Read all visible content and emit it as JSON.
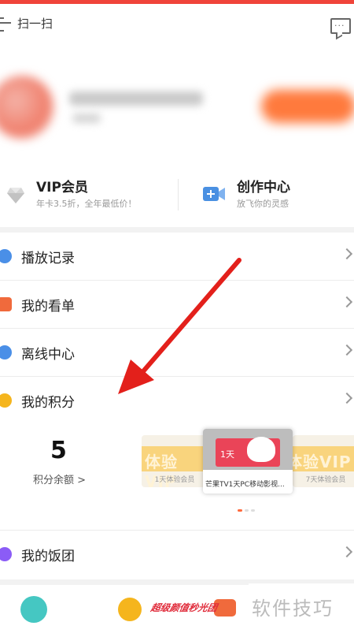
{
  "header": {
    "scan_label": "扫一扫"
  },
  "cards": {
    "vip": {
      "title": "VIP会员",
      "subtitle": "年卡3.5折，全年最低价！"
    },
    "create": {
      "title": "创作中心",
      "subtitle": "放飞你的灵感"
    }
  },
  "menu": [
    {
      "label": "播放记录",
      "icon": "history-icon",
      "color": "#4a8fe7"
    },
    {
      "label": "我的看单",
      "icon": "heart-list-icon",
      "color": "#f06a3c"
    },
    {
      "label": "离线中心",
      "icon": "download-icon",
      "color": "#4a8fe7"
    },
    {
      "label": "我的积分",
      "icon": "points-icon",
      "color": "#f5b51d"
    }
  ],
  "points": {
    "value": "5",
    "label": "积分余额 >"
  },
  "banners": {
    "left": {
      "text": "体验VIP",
      "caption": "1天体验会员"
    },
    "main": {
      "ticket": "1天",
      "caption": "芒果TV1天PC移动影视..."
    },
    "right": {
      "text": "体验VIP",
      "caption": "7天体验会员"
    }
  },
  "group": {
    "label": "我的饭团",
    "icon": "group-icon",
    "color": "#8b5cf6"
  },
  "bottom": {
    "promo": "超级颜值秒光团",
    "watermark": "软件技巧"
  },
  "colors": {
    "accent": "#f0443a",
    "arrow": "#e3201b"
  }
}
